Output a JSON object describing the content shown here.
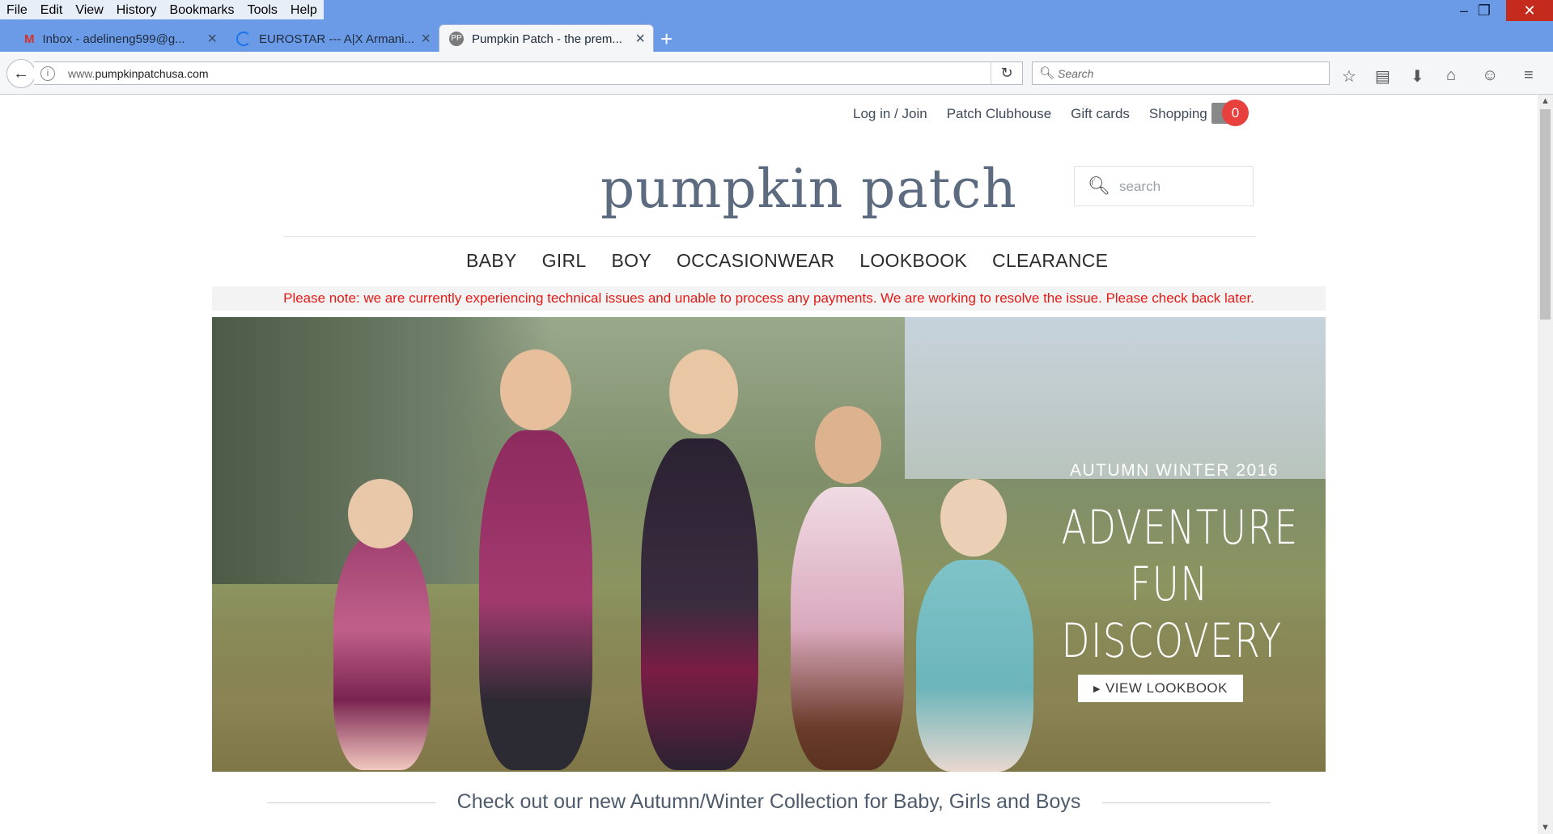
{
  "browser": {
    "menu": [
      "File",
      "Edit",
      "View",
      "History",
      "Bookmarks",
      "Tools",
      "Help"
    ],
    "tabs": [
      {
        "label": "Inbox - adelineng599@g...",
        "icon": "gmail-icon"
      },
      {
        "label": "EUROSTAR --- A|X Armani...",
        "icon": "loading-icon"
      },
      {
        "label": "Pumpkin Patch - the prem...",
        "icon": "pp-favicon"
      }
    ],
    "url_prefix": "www.",
    "url_domain": "pumpkinpatchusa.com",
    "search_placeholder": "Search"
  },
  "site": {
    "toplinks": [
      "Log in / Join",
      "Patch Clubhouse",
      "Gift cards",
      "Shopping Bag"
    ],
    "cart_count": "0",
    "logo": "pumpkin patch",
    "search_placeholder": "search",
    "nav": [
      "BABY",
      "GIRL",
      "BOY",
      "OCCASIONWEAR",
      "LOOKBOOK",
      "CLEARANCE"
    ],
    "notice": "Please note: we are currently experiencing technical issues and unable to process any payments. We are working to resolve the issue. Please check back later.",
    "hero": {
      "subtitle": "AUTUMN WINTER 2016",
      "title_line1": "ADVENTURE",
      "title_line2": "FUN DISCOVERY",
      "button": "VIEW LOOKBOOK"
    },
    "caption": "Check out our new Autumn/Winter Collection for Baby, Girls and Boys"
  },
  "colors": {
    "titlebar": "#6b9be6",
    "notice_text": "#e41b17",
    "cart_badge": "#e8403d",
    "logo": "#5c6b80"
  }
}
